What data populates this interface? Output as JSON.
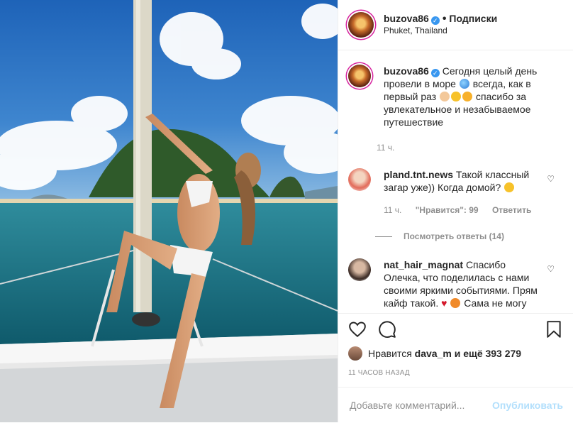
{
  "header": {
    "username": "buzova86",
    "follow_label": "Подписки",
    "location": "Phuket, Thailand",
    "verified_icon": "verified-check-icon"
  },
  "caption": {
    "username": "buzova86",
    "text_part1": "Сегодня целый день провели в море",
    "text_part2": "всегда, как в первый раз",
    "text_part3": "спасибо за увлекательное и незабываемое путешествие",
    "time": "11 ч."
  },
  "comments": [
    {
      "username": "pland.tnt.news",
      "text": "Такой классный загар уже)) Когда домой?",
      "time": "11 ч.",
      "likes": "\"Нравится\": 99",
      "reply": "Ответить",
      "view_replies": "Посмотреть ответы (14)"
    },
    {
      "username": "nat_hair_magnat",
      "text_part1": "Спасибо Олечка, что поделилась с нами своими яркими событиями. Прям кайф такой.",
      "text_part2": "Сама не могу поехать, хоть так"
    }
  ],
  "likes": {
    "prefix": "Нравится",
    "user": "dava_m",
    "suffix": "и ещё 393 279"
  },
  "post_time": "11 ЧАСОВ НАЗАД",
  "add_comment": {
    "placeholder": "Добавьте комментарий...",
    "publish_label": "Опубликовать"
  },
  "colors": {
    "accent_blue": "#3897f0",
    "publish_disabled": "#b2dffc",
    "muted_text": "#8e8e8e"
  }
}
